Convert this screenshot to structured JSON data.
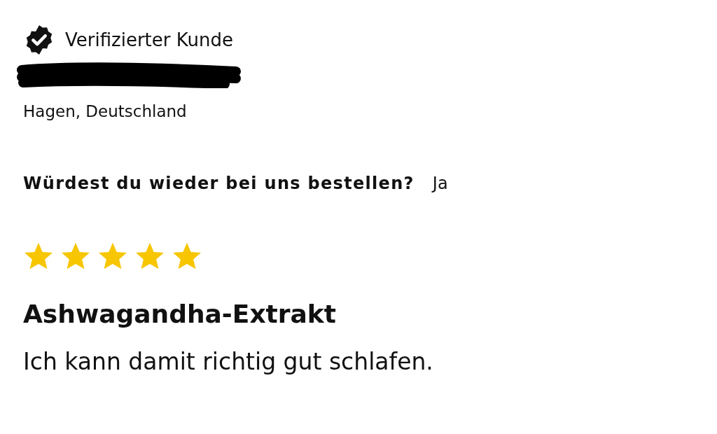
{
  "badge": {
    "label": "Verifizierter Kunde"
  },
  "reviewer": {
    "redacted": true,
    "location": "Hagen, Deutschland"
  },
  "question": {
    "label": "Würdest du wieder bei uns bestellen?",
    "answer": "Ja"
  },
  "rating": {
    "stars": 5
  },
  "review": {
    "title": "Ashwagandha-Extrakt",
    "body": "Ich kann damit richtig gut schlafen."
  }
}
